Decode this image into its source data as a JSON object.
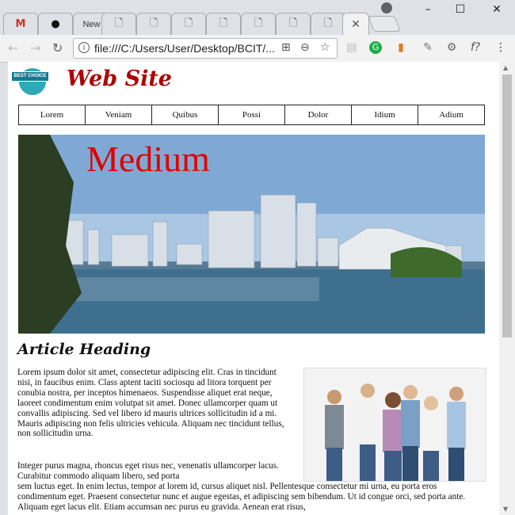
{
  "browser": {
    "tabs": [
      {
        "icon": "gmail-icon",
        "label": ""
      },
      {
        "icon": "github-icon",
        "label": ""
      },
      {
        "icon": "page-icon",
        "label": "New"
      },
      {
        "icon": "page-icon",
        "label": ""
      },
      {
        "icon": "page-icon",
        "label": ""
      },
      {
        "icon": "page-icon",
        "label": ""
      },
      {
        "icon": "page-icon",
        "label": ""
      },
      {
        "icon": "page-icon",
        "label": ""
      },
      {
        "icon": "page-icon",
        "label": ""
      },
      {
        "icon": "page-icon",
        "label": ""
      },
      {
        "icon": "page-icon",
        "label": ""
      }
    ],
    "address": "file:///C:/Users/User/Desktop/BCIT/...",
    "colors": {
      "chrome_bg": "#dee1e6",
      "toolbar_bg": "#f2f2f2"
    }
  },
  "page": {
    "site_title": "Web Site",
    "logo_text": "BEST CHOICE",
    "nav": [
      "Lorem",
      "Veniam",
      "Quibus",
      "Possi",
      "Dolor",
      "Idium",
      "Adium"
    ],
    "hero_title": "Medium",
    "article_heading": "Article Heading",
    "paragraph1": "Lorem ipsum dolor sit amet, consectetur adipiscing elit. Cras in tincidunt nisi, in faucibus enim. Class aptent taciti sociosqu ad litora torquent per conubia nostra, per inceptos himenaeos. Suspendisse aliquet erat neque, laoreet condimentum enim volutpat sit amet. Donec ullamcorper quam ut convallis adipiscing. Sed vel libero id mauris ultrices sollicitudin id a mi. Mauris adipiscing non felis ultricies vehicula. Aliquam nec tincidunt tellus, non sollicitudin urna.",
    "paragraph2_line1": "Integer purus magna, rhoncus eget risus nec, venenatis ullamcorper lacus. Curabitur commodo aliquam libero, sed porta",
    "paragraph2_rest": "sem luctus eget. In enim lectus, tempor at lorem id, cursus aliquet nisl. Pellentesque consectetur mi urna, eu porta eros condimentum eget. Praesent consectetur nunc et augue egestas, et adipiscing sem bibendum. Ut id congue orci, sed porta ante. Aliquam eget lacus elit. Etiam accumsan nec purus eu gravida. Aenean erat risus,",
    "colors": {
      "title_red": "#b00000",
      "hero_red": "#e00000"
    }
  }
}
